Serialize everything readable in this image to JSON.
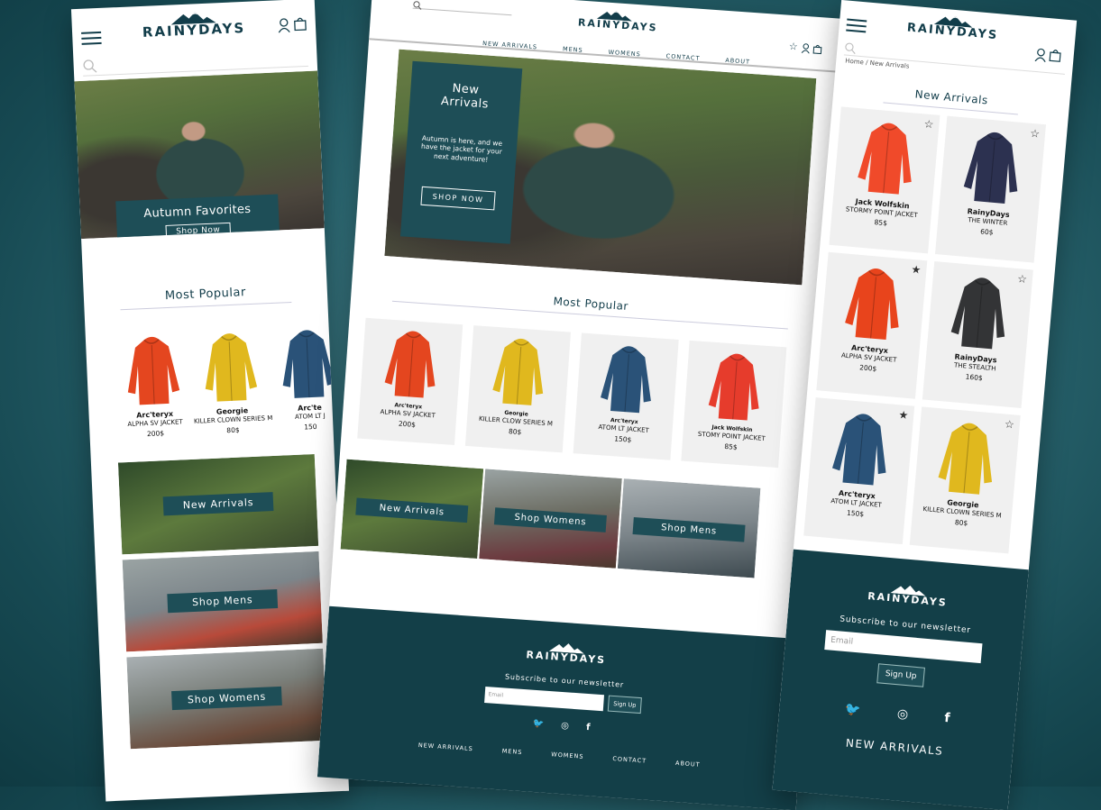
{
  "brand": {
    "name": "RAINYDAYS"
  },
  "colors": {
    "primary": "#1e4e57",
    "footer": "#133f48",
    "text": "#123d4a"
  },
  "desktop": {
    "nav": [
      "NEW ARRIVALS",
      "MENS",
      "WOMENS",
      "CONTACT",
      "ABOUT"
    ],
    "hero": {
      "title_line1": "New",
      "title_line2": "Arrivals",
      "text": "Autumn is here, and we have the jacket for your next adventure!",
      "button": "SHOP NOW"
    },
    "popular_title": "Most Popular",
    "products": [
      {
        "brand": "Arc'teryx",
        "name": "ALPHA SV JACKET",
        "price": "200$",
        "color": "#e4461f"
      },
      {
        "brand": "Georgie",
        "name": "KILLER CLOW SERIES M",
        "price": "80$",
        "color": "#e0b81e"
      },
      {
        "brand": "Arc'teryx",
        "name": "ATOM LT JACKET",
        "price": "150$",
        "color": "#2a5278"
      },
      {
        "brand": "Jack Wolfskin",
        "name": "STOMY POINT JACKET",
        "price": "85$",
        "color": "#e63c2c"
      }
    ],
    "banners": [
      "New Arrivals",
      "Shop Womens",
      "Shop Mens"
    ],
    "footer": {
      "subscribe": "Subscribe to our newsletter",
      "email_placeholder": "Email",
      "signup": "Sign Up",
      "links": [
        "NEW ARRIVALS",
        "MENS",
        "WOMENS",
        "CONTACT",
        "ABOUT"
      ]
    }
  },
  "mobile_left": {
    "hero": {
      "title": "Autumn Favorites",
      "button": "Shop Now"
    },
    "popular_title": "Most Popular",
    "products": [
      {
        "brand": "Arc'teryx",
        "name": "ALPHA SV JACKET",
        "price": "200$",
        "color": "#e4461f"
      },
      {
        "brand": "Georgie",
        "name": "KILLER CLOWN SERIES M",
        "price": "80$",
        "color": "#e0b81e"
      },
      {
        "brand": "Arc'te",
        "name": "ATOM LT J",
        "price": "150",
        "color": "#2a5278"
      }
    ],
    "banners": [
      "New Arrivals",
      "Shop Mens",
      "Shop Womens"
    ]
  },
  "mobile_right": {
    "breadcrumb": "Home / New Arrivals",
    "title": "New Arrivals",
    "products": [
      {
        "brand": "Jack Wolfskin",
        "name": "STORMY POINT JACKET",
        "price": "85$",
        "color": "#f04a2a",
        "star": "☆"
      },
      {
        "brand": "RainyDays",
        "name": "THE WINTER",
        "price": "60$",
        "color": "#2c3150",
        "star": "☆"
      },
      {
        "brand": "Arc'teryx",
        "name": "ALPHA SV JACKET",
        "price": "200$",
        "color": "#e8441c",
        "star": "★"
      },
      {
        "brand": "RainyDays",
        "name": "THE STEALTH",
        "price": "160$",
        "color": "#333436",
        "star": "☆"
      },
      {
        "brand": "Arc'teryx",
        "name": "ATOM LT JACKET",
        "price": "150$",
        "color": "#2a5278",
        "star": "★"
      },
      {
        "brand": "Georgie",
        "name": "KILLER CLOWN SERIES M",
        "price": "80$",
        "color": "#e0b81e",
        "star": "☆"
      }
    ],
    "footer": {
      "subscribe": "Subscribe to our newsletter",
      "email_placeholder": "Email",
      "signup": "Sign Up",
      "bottom_link": "NEW ARRIVALS"
    }
  }
}
